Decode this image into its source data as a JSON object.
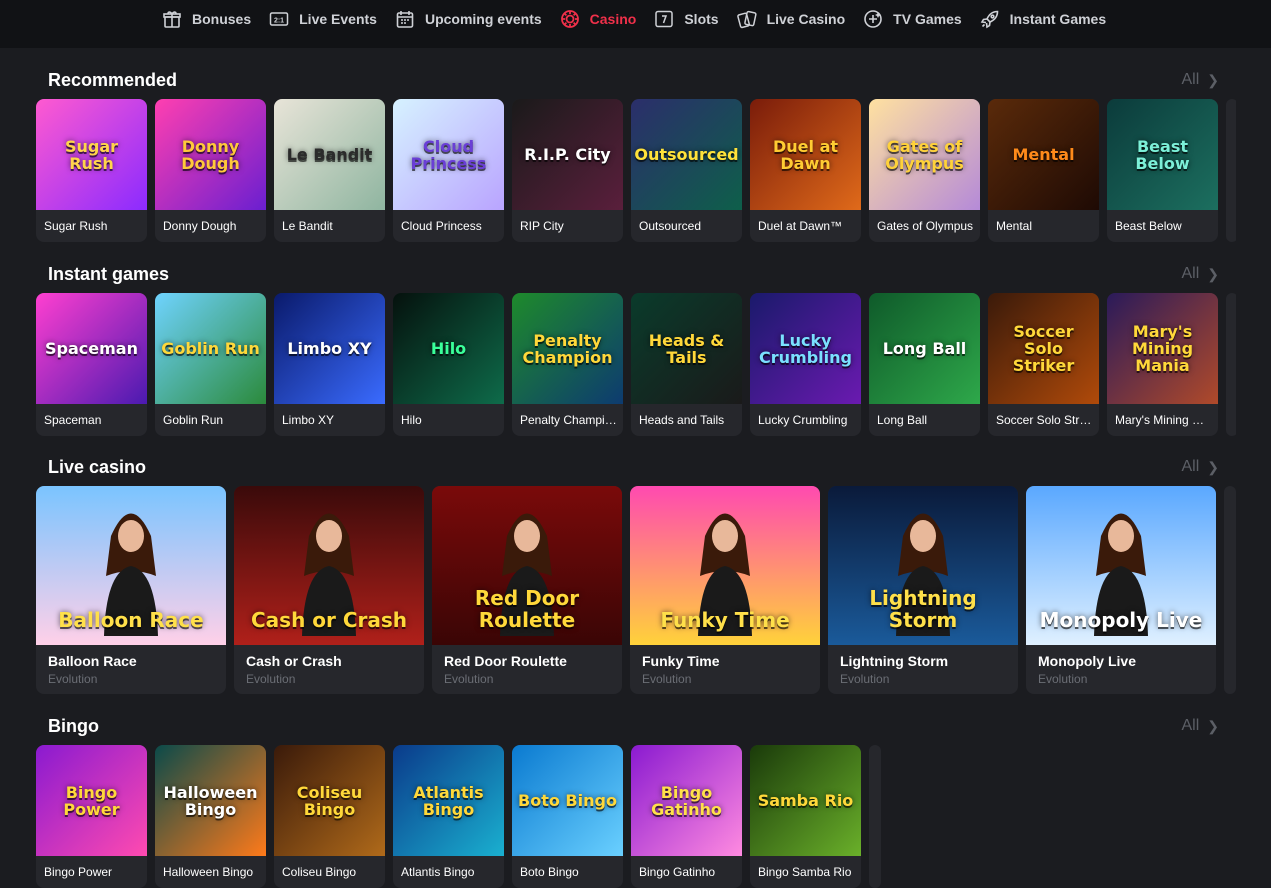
{
  "nav": [
    {
      "label": "Bonuses",
      "icon": "gift-icon",
      "active": false
    },
    {
      "label": "Live Events",
      "icon": "live-events-icon",
      "active": false
    },
    {
      "label": "Upcoming events",
      "icon": "calendar-icon",
      "active": false
    },
    {
      "label": "Casino",
      "icon": "casino-chip-icon",
      "active": true
    },
    {
      "label": "Slots",
      "icon": "slots-icon",
      "active": false
    },
    {
      "label": "Live Casino",
      "icon": "cards-icon",
      "active": false
    },
    {
      "label": "TV Games",
      "icon": "tv-games-icon",
      "active": false
    },
    {
      "label": "Instant Games",
      "icon": "rocket-icon",
      "active": false
    }
  ],
  "colors": {
    "accent": "#f0304a",
    "background": "#1b1c20",
    "card": "#26272c",
    "muted": "#5c5f66"
  },
  "sections": {
    "recommended": {
      "title": "Recommended",
      "all_label": "All",
      "games": [
        {
          "name": "Sugar Rush",
          "art": "Sugar Rush",
          "bg": "linear-gradient(135deg,#ff5ad0,#8b2bff)",
          "fg": "#ffd54a"
        },
        {
          "name": "Donny Dough",
          "art": "Donny Dough",
          "bg": "linear-gradient(135deg,#ff3fb0,#6a1fd0)",
          "fg": "#ffc93a"
        },
        {
          "name": "Le Bandit",
          "art": "Le Bandit",
          "bg": "linear-gradient(135deg,#e8e4d8,#8fb5a0)",
          "fg": "#2b2b2b"
        },
        {
          "name": "Cloud Princess",
          "art": "Cloud Princess",
          "bg": "linear-gradient(135deg,#d6f2ff,#b9a4ff)",
          "fg": "#6a3fd6"
        },
        {
          "name": "RIP City",
          "art": "R.I.P. City",
          "bg": "linear-gradient(135deg,#1a1a1a,#5a1f3c)",
          "fg": "#ffffff"
        },
        {
          "name": "Outsourced",
          "art": "Outsourced",
          "bg": "linear-gradient(135deg,#2b2e6b,#0e5f4a)",
          "fg": "#ffe23a"
        },
        {
          "name": "Duel at Dawn™",
          "art": "Duel at Dawn",
          "bg": "linear-gradient(135deg,#7a1c0a,#e06a1a)",
          "fg": "#ffcc33"
        },
        {
          "name": "Gates of Olympus",
          "art": "Gates of Olympus",
          "bg": "linear-gradient(135deg,#ffe1a0,#b58ad8)",
          "fg": "#ffd23a"
        },
        {
          "name": "Mental",
          "art": "Mental",
          "bg": "linear-gradient(135deg,#5a2a0a,#1e0a04)",
          "fg": "#ff8a1a"
        },
        {
          "name": "Beast Below",
          "art": "Beast Below",
          "bg": "linear-gradient(135deg,#0b3b3b,#1c6f5f)",
          "fg": "#7cf0d8"
        }
      ]
    },
    "instant": {
      "title": "Instant games",
      "all_label": "All",
      "games": [
        {
          "name": "Spaceman",
          "art": "Spaceman",
          "bg": "linear-gradient(135deg,#ff3fd0,#4a1ab0)",
          "fg": "#ffffff"
        },
        {
          "name": "Goblin Run",
          "art": "Goblin Run",
          "bg": "linear-gradient(135deg,#6fd3ff,#2b8a3b)",
          "fg": "#ffd83a"
        },
        {
          "name": "Limbo XY",
          "art": "Limbo XY",
          "bg": "linear-gradient(135deg,#0a1a6b,#3a6bff)",
          "fg": "#ffffff"
        },
        {
          "name": "Hilo",
          "art": "Hilo",
          "bg": "linear-gradient(135deg,#05110d,#0e6b4a)",
          "fg": "#3aff9a"
        },
        {
          "name": "Penalty Champion",
          "art": "Penalty Champion",
          "bg": "linear-gradient(135deg,#1e8a2b,#0d3b70)",
          "fg": "#ffd83a"
        },
        {
          "name": "Heads and Tails",
          "art": "Heads & Tails",
          "bg": "linear-gradient(135deg,#0a3b2b,#1a1a1a)",
          "fg": "#ffd83a"
        },
        {
          "name": "Lucky Crumbling",
          "art": "Lucky Crumbling",
          "bg": "linear-gradient(135deg,#1a1a6b,#6a1ab0)",
          "fg": "#7ae0ff"
        },
        {
          "name": "Long Ball",
          "art": "Long Ball",
          "bg": "linear-gradient(135deg,#0f5a2a,#2ea84a)",
          "fg": "#ffffff"
        },
        {
          "name": "Soccer Solo Striker",
          "art": "Soccer Solo Striker",
          "bg": "linear-gradient(135deg,#3a1a0a,#b04a0a)",
          "fg": "#ffd83a"
        },
        {
          "name": "Mary's Mining Mania",
          "art": "Mary's Mining Mania",
          "bg": "linear-gradient(135deg,#2a1a5a,#b04a2a)",
          "fg": "#ffd83a"
        }
      ]
    },
    "live": {
      "title": "Live casino",
      "all_label": "All",
      "games": [
        {
          "name": "Balloon Race",
          "provider": "Evolution",
          "art": "Balloon Race",
          "bg": "linear-gradient(180deg,#7ac4ff,#ffd0e8)",
          "fg": "#ffe04a"
        },
        {
          "name": "Cash or Crash",
          "provider": "Evolution",
          "art": "Cash or Crash",
          "bg": "linear-gradient(180deg,#3a0a0a,#b0201a)",
          "fg": "#ffd83a"
        },
        {
          "name": "Red Door Roulette",
          "provider": "Evolution",
          "art": "Red Door Roulette",
          "bg": "linear-gradient(180deg,#7a0a0a,#3a0505)",
          "fg": "#ffd83a"
        },
        {
          "name": "Funky Time",
          "provider": "Evolution",
          "art": "Funky Time",
          "bg": "linear-gradient(180deg,#ff4ab0,#ffd23a)",
          "fg": "#ffe04a"
        },
        {
          "name": "Lightning Storm",
          "provider": "Evolution",
          "art": "Lightning Storm",
          "bg": "linear-gradient(180deg,#0a1a3a,#1a5a9a)",
          "fg": "#ffe04a"
        },
        {
          "name": "Monopoly Live",
          "provider": "Evolution",
          "art": "Monopoly Live",
          "bg": "linear-gradient(180deg,#5aa8ff,#dff0ff)",
          "fg": "#ffffff"
        }
      ]
    },
    "bingo": {
      "title": "Bingo",
      "all_label": "All",
      "games": [
        {
          "name": "Bingo Power",
          "art": "Bingo Power",
          "bg": "linear-gradient(135deg,#8a1ad0,#ff4ab0)",
          "fg": "#ffd83a"
        },
        {
          "name": "Halloween Bingo",
          "art": "Halloween Bingo",
          "bg": "linear-gradient(135deg,#0a4a4a,#ff7a1a)",
          "fg": "#ffffff"
        },
        {
          "name": "Coliseu Bingo",
          "art": "Coliseu Bingo",
          "bg": "linear-gradient(135deg,#3a1a0a,#b06a1a)",
          "fg": "#ffd83a"
        },
        {
          "name": "Atlantis Bingo",
          "art": "Atlantis Bingo",
          "bg": "linear-gradient(135deg,#0a3a8a,#1ab0d0)",
          "fg": "#ffd83a"
        },
        {
          "name": "Boto Bingo",
          "art": "Boto Bingo",
          "bg": "linear-gradient(135deg,#0a7ad0,#6ad0ff)",
          "fg": "#ffd83a"
        },
        {
          "name": "Bingo Gatinho",
          "art": "Bingo Gatinho",
          "bg": "linear-gradient(135deg,#8a1ad0,#ff8ae0)",
          "fg": "#ffe04a"
        },
        {
          "name": "Bingo Samba Rio",
          "art": "Samba Rio",
          "bg": "linear-gradient(135deg,#1a3a0a,#6ab02a)",
          "fg": "#ffd83a"
        }
      ]
    }
  }
}
